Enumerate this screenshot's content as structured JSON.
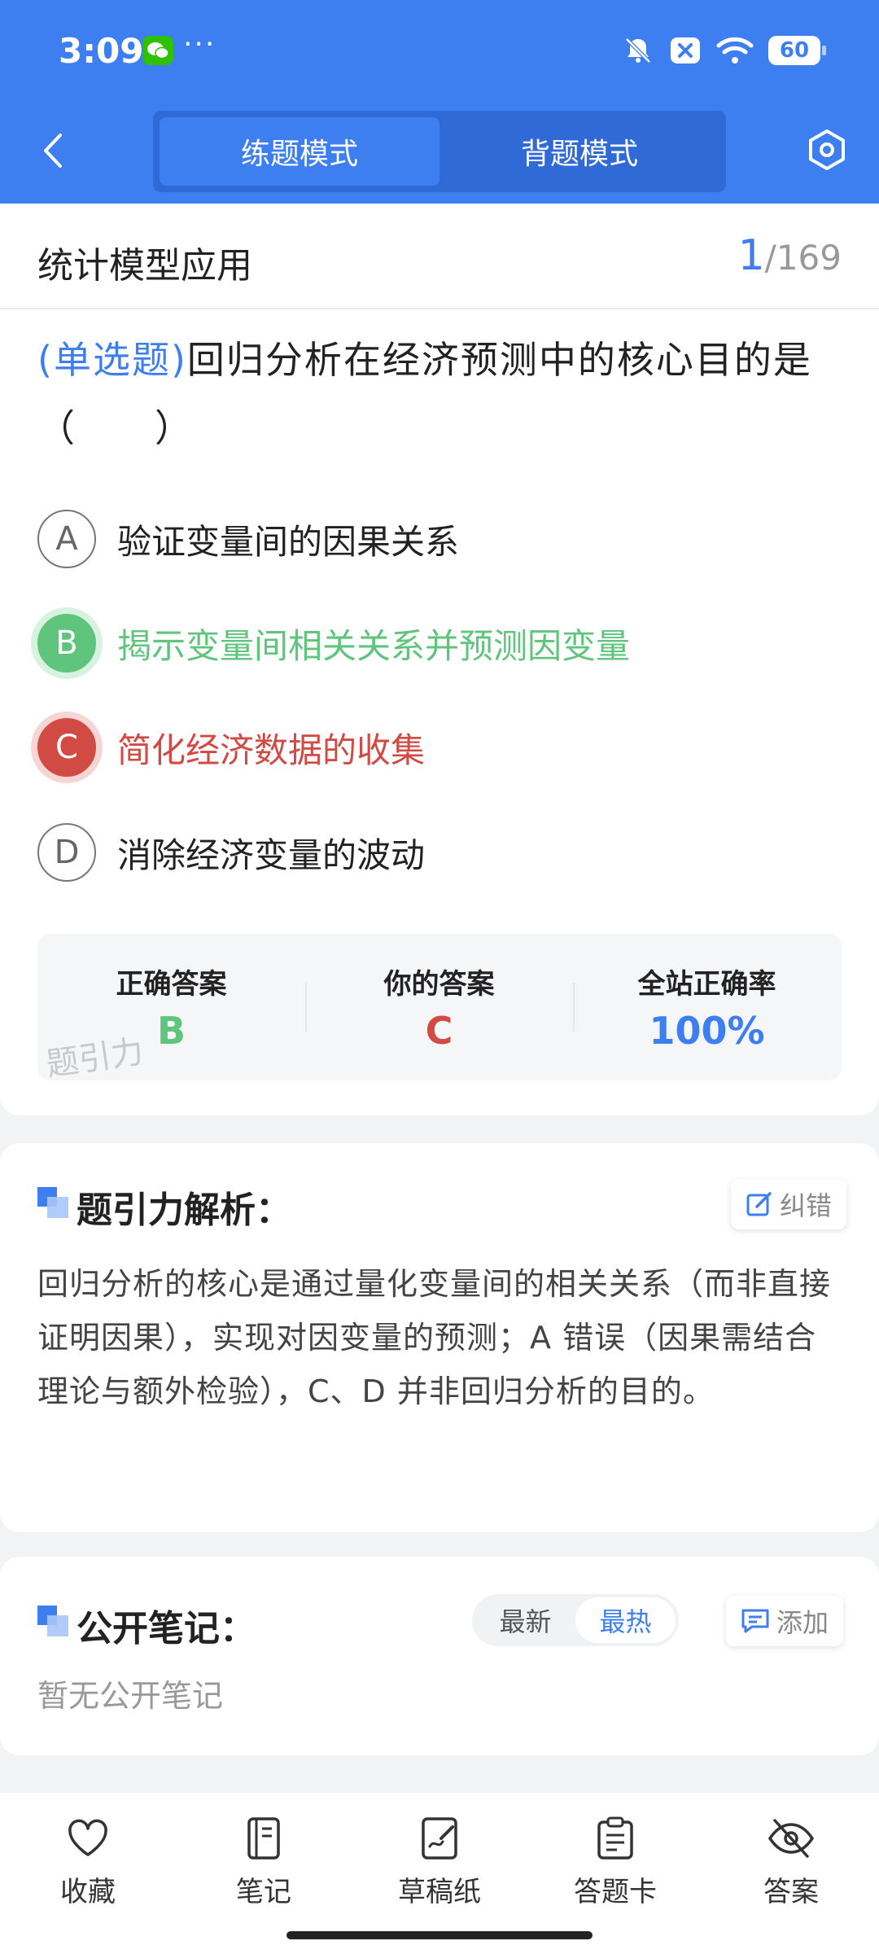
{
  "status": {
    "time": "3:09",
    "dots": "···",
    "battery": "60"
  },
  "nav": {
    "tabs": [
      {
        "label": "练题模式",
        "active": true
      },
      {
        "label": "背题模式",
        "active": false
      }
    ]
  },
  "question": {
    "subject": "统计模型应用",
    "index": "1",
    "total": "/169",
    "type_label": "(单选题)",
    "text": "回归分析在经济预测中的核心目的是（　　）",
    "options": [
      {
        "letter": "A",
        "text": "验证变量间的因果关系",
        "state": "normal"
      },
      {
        "letter": "B",
        "text": "揭示变量间相关关系并预测因变量",
        "state": "correct"
      },
      {
        "letter": "C",
        "text": "简化经济数据的收集",
        "state": "wrong"
      },
      {
        "letter": "D",
        "text": "消除经济变量的波动",
        "state": "normal"
      }
    ]
  },
  "stats": {
    "correct_label": "正确答案",
    "correct_value": "B",
    "yours_label": "你的答案",
    "yours_value": "C",
    "rate_label": "全站正确率",
    "rate_value": "100%",
    "watermark": "题引力",
    "colors": {
      "correct": "#5fc47c",
      "wrong": "#d14a43",
      "accent": "#3d7ff0"
    }
  },
  "analysis": {
    "title": "题引力解析：",
    "report_label": "纠错",
    "text": "回归分析的核心是通过量化变量间的相关关系（而非直接证明因果），实现对因变量的预测；A 错误（因果需结合理论与额外检验），C、D 并非回归分析的目的。"
  },
  "notes": {
    "title": "公开笔记：",
    "sort": [
      {
        "label": "最新",
        "active": false
      },
      {
        "label": "最热",
        "active": true
      }
    ],
    "add_label": "添加",
    "empty": "暂无公开笔记"
  },
  "bottom_bar": [
    {
      "label": "收藏",
      "icon": "heart-icon"
    },
    {
      "label": "笔记",
      "icon": "notebook-icon"
    },
    {
      "label": "草稿纸",
      "icon": "draft-paper-icon"
    },
    {
      "label": "答题卡",
      "icon": "answer-sheet-icon"
    },
    {
      "label": "答案",
      "icon": "eye-off-icon"
    }
  ]
}
